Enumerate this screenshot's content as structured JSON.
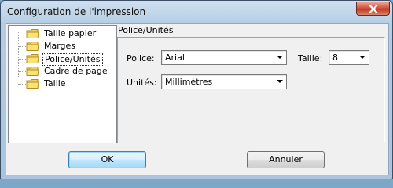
{
  "window": {
    "title": "Configuration de l'impression",
    "close_label": "×"
  },
  "tree": {
    "items": [
      {
        "label": "Taille papier",
        "selected": false
      },
      {
        "label": "Marges",
        "selected": false
      },
      {
        "label": "Police/Unités",
        "selected": true
      },
      {
        "label": "Cadre de page",
        "selected": false
      },
      {
        "label": "Taille",
        "selected": false
      }
    ]
  },
  "panel": {
    "title": "Police/Unités",
    "police_label": "Police:",
    "police_value": "Arial",
    "taille_label": "Taille:",
    "taille_value": "8",
    "unites_label": "Unités:",
    "unites_value": "Millimètres"
  },
  "buttons": {
    "ok": "OK",
    "cancel": "Annuler"
  },
  "colors": {
    "folder": "#f2d25c",
    "close": "#c84a33",
    "default_button": "#3c7fb1"
  }
}
